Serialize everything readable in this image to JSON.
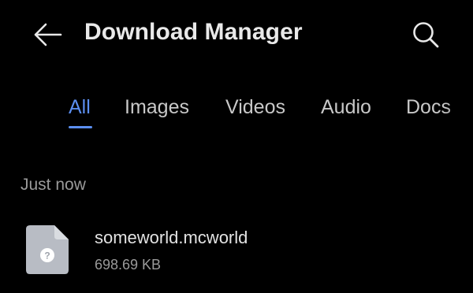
{
  "header": {
    "title": "Download Manager",
    "back_icon": "arrow-left-icon",
    "search_icon": "search-icon"
  },
  "tabs": [
    {
      "label": "All",
      "active": true
    },
    {
      "label": "Images",
      "active": false
    },
    {
      "label": "Videos",
      "active": false
    },
    {
      "label": "Audio",
      "active": false
    },
    {
      "label": "Docs",
      "active": false
    }
  ],
  "sections": [
    {
      "header": "Just now",
      "items": [
        {
          "name": "someworld.mcworld",
          "size": "698.69 KB",
          "icon": "unknown-file-icon"
        }
      ]
    }
  ],
  "colors": {
    "background": "#000000",
    "accent": "#5b8ef0",
    "primary_text": "#e6e6e6",
    "secondary_text": "#9a9a9a",
    "file_icon": "#b8bcc4"
  }
}
